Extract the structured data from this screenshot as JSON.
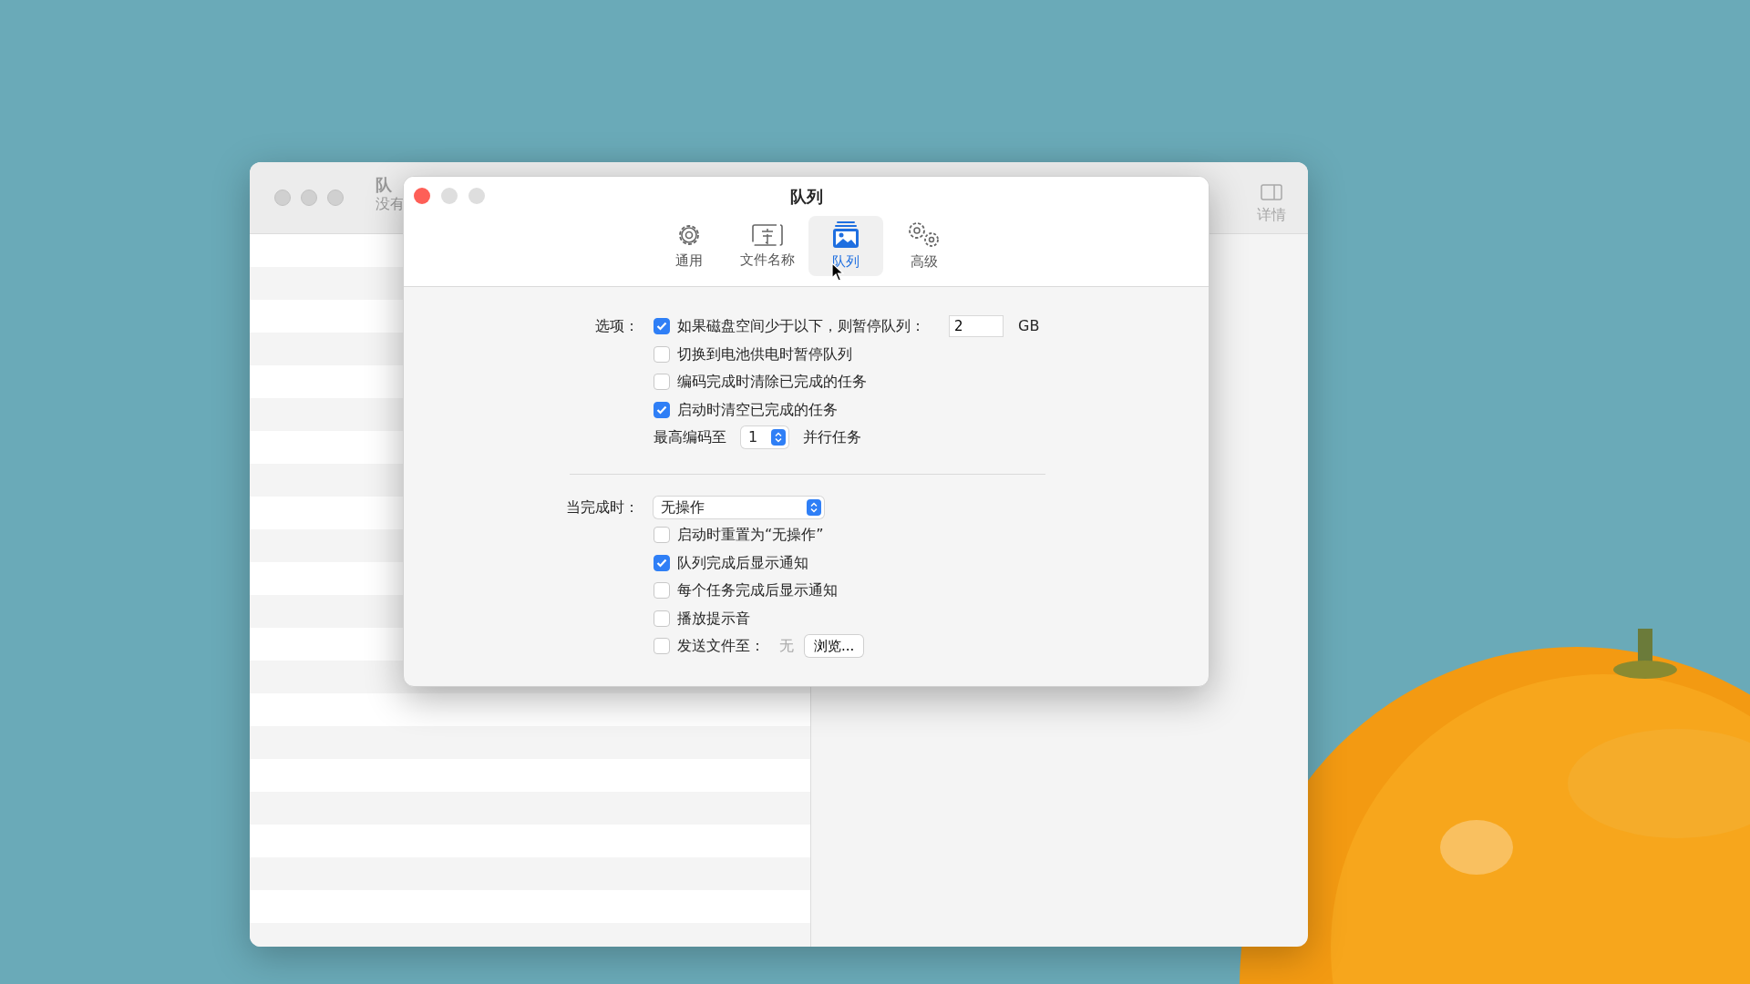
{
  "background_window": {
    "title": "队",
    "subtitle": "没有",
    "toolbar": [
      {
        "label": "详情"
      }
    ]
  },
  "dialog": {
    "title": "队列",
    "tabs": [
      {
        "label": "通用",
        "selected": false
      },
      {
        "label": "文件名称",
        "selected": false
      },
      {
        "label": "队列",
        "selected": true
      },
      {
        "label": "高级",
        "selected": false
      }
    ],
    "options": {
      "label": "选项：",
      "items": [
        {
          "kind": "checkbox",
          "label": "如果磁盘空间少于以下，则暂停队列：",
          "checked": true,
          "value": "2",
          "unit": "GB"
        },
        {
          "kind": "checkbox",
          "label": "切换到电池供电时暂停队列",
          "checked": false
        },
        {
          "kind": "checkbox",
          "label": "编码完成时清除已完成的任务",
          "checked": false
        },
        {
          "kind": "checkbox",
          "label": "启动时清空已完成的任务",
          "checked": true
        },
        {
          "kind": "stepper",
          "label": "最高编码至",
          "value": "1",
          "suffix": "并行任务"
        }
      ]
    },
    "completion": {
      "label": "当完成时：",
      "popup": "无操作",
      "items": [
        {
          "kind": "checkbox",
          "label": "启动时重置为“无操作”",
          "checked": false
        },
        {
          "kind": "checkbox",
          "label": "队列完成后显示通知",
          "checked": true
        },
        {
          "kind": "checkbox",
          "label": "每个任务完成后显示通知",
          "checked": false
        },
        {
          "kind": "checkbox",
          "label": "播放提示音",
          "checked": false
        },
        {
          "kind": "checkbox",
          "label": "发送文件至：",
          "checked": false,
          "path": "无",
          "button": "浏览..."
        }
      ]
    }
  }
}
